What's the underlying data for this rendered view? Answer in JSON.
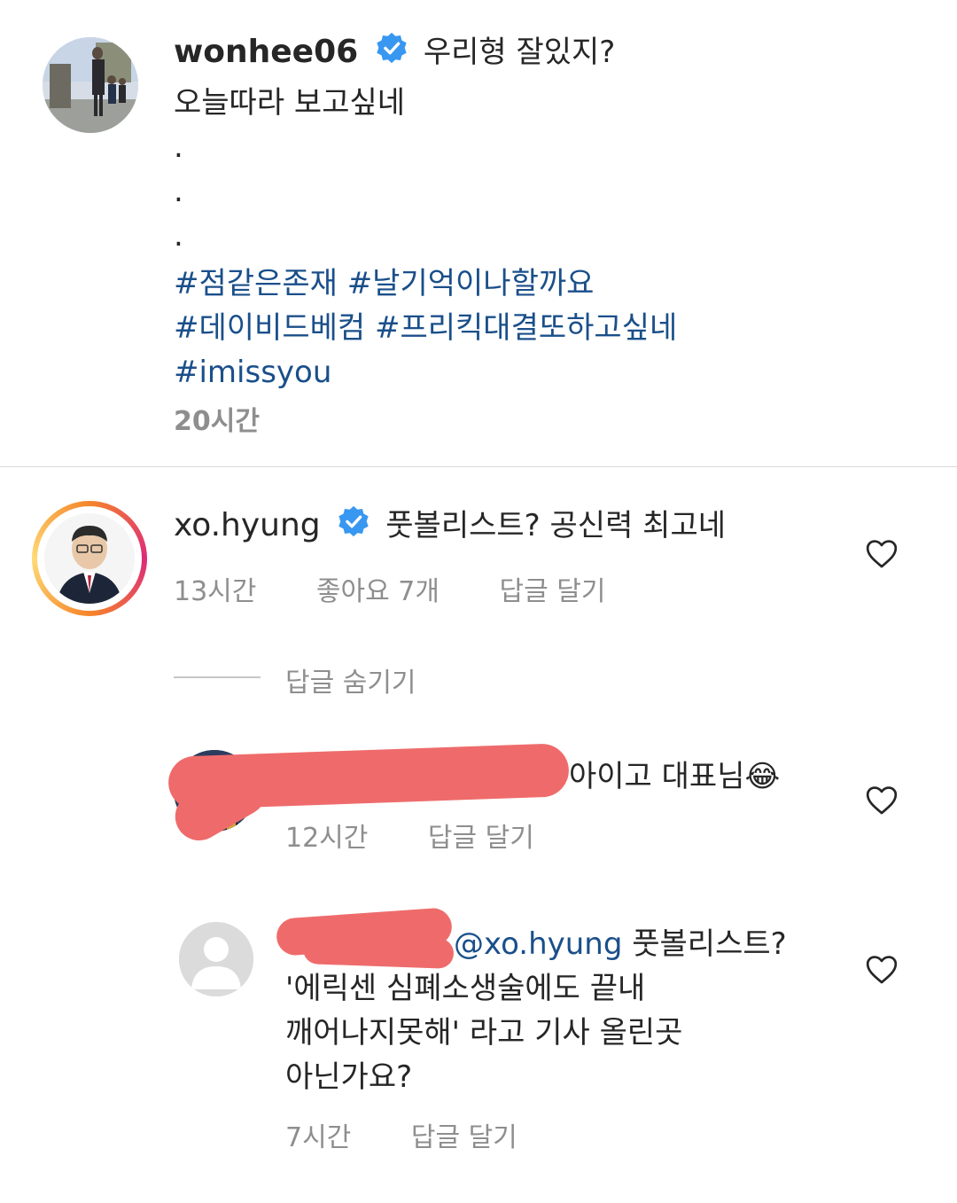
{
  "post": {
    "username": "wonhee06",
    "caption_line1": "우리형 잘있지?",
    "caption_line2": "오늘따라 보고싶네",
    "dots": [
      ".",
      ".",
      "."
    ],
    "hashtags_line1": "#점같은존재 #날기억이나할까요",
    "hashtags_line2": "#데이비드베컴 #프리킥대결또하고싶네",
    "hashtags_line3": "#imissyou",
    "time": "20시간"
  },
  "comment1": {
    "username": "xo.hyung",
    "text": "풋볼리스트? 공신력 최고네",
    "time": "13시간",
    "likes": "좋아요 7개",
    "reply_label": "답글 달기",
    "hide_replies": "답글 숨기기"
  },
  "reply1": {
    "text": "아이고 대표님😂",
    "time": "12시간",
    "reply_label": "답글 달기"
  },
  "reply2": {
    "mention": "@xo.hyung",
    "text_line1": " 풋볼리스트?",
    "text_line2": "'에릭센 심폐소생술에도 끝내",
    "text_line3": "깨어나지못해' 라고 기사 올린곳",
    "text_line4": "아닌가요?",
    "time": "7시간",
    "reply_label": "답글 달기"
  },
  "colors": {
    "accent_link": "#1a4f8a",
    "verified": "#3897f0",
    "redaction": "#ef6b6b"
  },
  "icons": [
    "verified-badge-icon",
    "heart-icon"
  ]
}
